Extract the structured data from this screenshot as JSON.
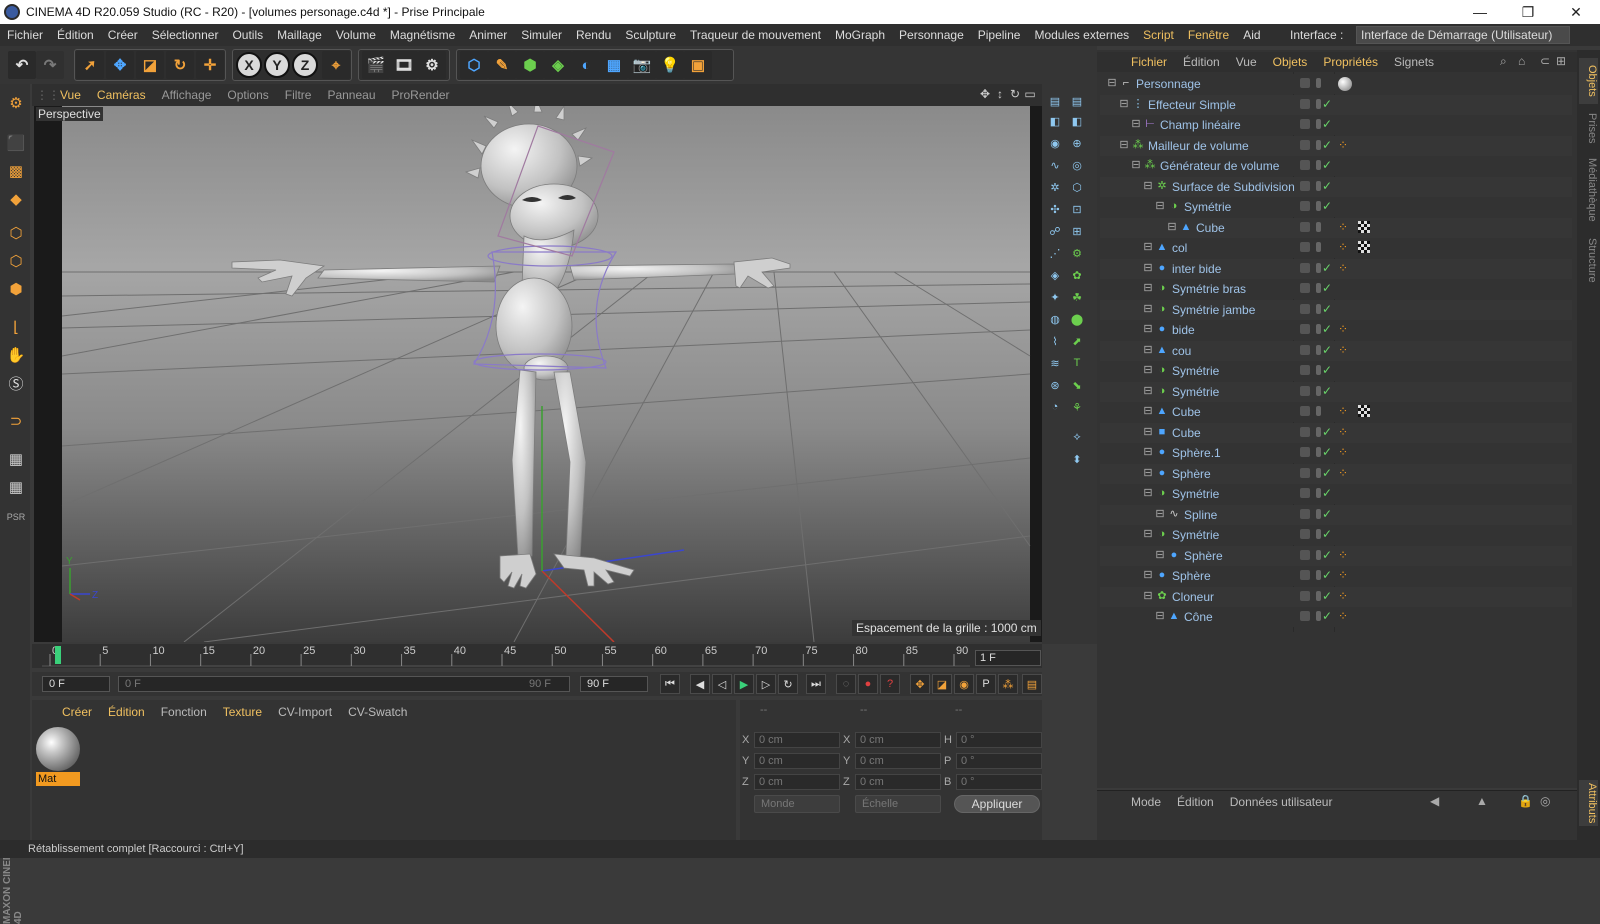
{
  "window": {
    "title": "CINEMA 4D R20.059 Studio (RC - R20) - [volumes personage.c4d *] - Prise Principale",
    "controls": [
      "—",
      "❐",
      "✕"
    ]
  },
  "menubar": {
    "items": [
      "Fichier",
      "Édition",
      "Créer",
      "Sélectionner",
      "Outils",
      "Maillage",
      "Volume",
      "Magnétisme",
      "Animer",
      "Simuler",
      "Rendu",
      "Sculpture",
      "Traqueur de mouvement",
      "MoGraph",
      "Personnage",
      "Pipeline",
      "Modules externes",
      "Script",
      "Fenêtre",
      "Aid"
    ],
    "interface_label": "Interface :",
    "interface_value": "Interface de Démarrage (Utilisateur)"
  },
  "viewport": {
    "menu": [
      "Vue",
      "Caméras",
      "Affichage",
      "Options",
      "Filtre",
      "Panneau",
      "ProRender"
    ],
    "camera_label": "Perspective",
    "grid_label": "Espacement de la grille : 1000 cm",
    "axis_labels": {
      "y": "Y",
      "z": "Z"
    }
  },
  "timeline": {
    "ticks": [
      "0",
      "5",
      "10",
      "15",
      "20",
      "25",
      "30",
      "35",
      "40",
      "45",
      "50",
      "55",
      "60",
      "65",
      "70",
      "75",
      "80",
      "85",
      "90"
    ],
    "current_frame": "1 F",
    "start_field": "0 F",
    "slider_start": "0 F",
    "slider_end": "90 F",
    "end_field": "90 F"
  },
  "material_manager": {
    "menu": [
      "Créer",
      "Édition",
      "Fonction",
      "Texture",
      "CV-Import",
      "CV-Swatch"
    ],
    "materials": [
      {
        "name": "Mat"
      }
    ]
  },
  "coordinates": {
    "headers": [
      "--",
      "--",
      "--"
    ],
    "rows": [
      {
        "a": "X",
        "av": "0 cm",
        "b": "X",
        "bv": "0 cm",
        "c": "H",
        "cv": "0 °"
      },
      {
        "a": "Y",
        "av": "0 cm",
        "b": "Y",
        "bv": "0 cm",
        "c": "P",
        "cv": "0 °"
      },
      {
        "a": "Z",
        "av": "0 cm",
        "b": "Z",
        "bv": "0 cm",
        "c": "B",
        "cv": "0 °"
      }
    ],
    "mode_select": "Monde",
    "scale_select": "Échelle",
    "apply_label": "Appliquer"
  },
  "object_manager": {
    "menu": [
      "Fichier",
      "Édition",
      "Vue",
      "Objets",
      "Propriétés",
      "Signets"
    ],
    "objects": [
      {
        "name": "Personnage",
        "depth": 0,
        "icon": "null-icon",
        "tags": [
          "sphere-mat"
        ],
        "check": false
      },
      {
        "name": "Effecteur Simple",
        "depth": 1,
        "icon": "effector-icon",
        "tags": [],
        "check": true
      },
      {
        "name": "Champ linéaire",
        "depth": 2,
        "icon": "field-icon",
        "tags": [],
        "check": true
      },
      {
        "name": "Mailleur de volume",
        "depth": 1,
        "icon": "volume-mesher-icon",
        "tags": [
          "phong"
        ],
        "check": true
      },
      {
        "name": "Générateur de volume",
        "depth": 2,
        "icon": "volume-builder-icon",
        "tags": [],
        "check": true
      },
      {
        "name": "Surface de Subdivision",
        "depth": 3,
        "icon": "subdivision-icon",
        "tags": [],
        "check": true
      },
      {
        "name": "Symétrie",
        "depth": 4,
        "icon": "symmetry-icon",
        "tags": [],
        "check": true
      },
      {
        "name": "Cube",
        "depth": 5,
        "icon": "polygon-icon",
        "tags": [
          "phong",
          "checker"
        ],
        "check": false
      },
      {
        "name": "col",
        "depth": 3,
        "icon": "polygon-icon",
        "tags": [
          "phong",
          "checker"
        ],
        "check": false
      },
      {
        "name": "inter bide",
        "depth": 3,
        "icon": "sphere-icon",
        "tags": [
          "phong"
        ],
        "check": true
      },
      {
        "name": "Symétrie bras",
        "depth": 3,
        "icon": "symmetry-icon",
        "tags": [],
        "check": true
      },
      {
        "name": "Symétrie jambe",
        "depth": 3,
        "icon": "symmetry-icon",
        "tags": [],
        "check": true
      },
      {
        "name": "bide",
        "depth": 3,
        "icon": "sphere-icon",
        "tags": [
          "phong"
        ],
        "check": true
      },
      {
        "name": "cou",
        "depth": 3,
        "icon": "cone-icon",
        "tags": [
          "phong"
        ],
        "check": true
      },
      {
        "name": "Symétrie",
        "depth": 3,
        "icon": "symmetry-icon",
        "tags": [],
        "check": true
      },
      {
        "name": "Symétrie",
        "depth": 3,
        "icon": "symmetry-icon",
        "tags": [],
        "check": true
      },
      {
        "name": "Cube",
        "depth": 3,
        "icon": "polygon-icon",
        "tags": [
          "phong",
          "checker"
        ],
        "check": false
      },
      {
        "name": "Cube",
        "depth": 3,
        "icon": "cube-icon",
        "tags": [
          "phong"
        ],
        "check": true
      },
      {
        "name": "Sphère.1",
        "depth": 3,
        "icon": "sphere-icon",
        "tags": [
          "phong"
        ],
        "check": true
      },
      {
        "name": "Sphère",
        "depth": 3,
        "icon": "sphere-icon",
        "tags": [
          "phong"
        ],
        "check": true
      },
      {
        "name": "Symétrie",
        "depth": 3,
        "icon": "symmetry-icon",
        "tags": [],
        "check": true
      },
      {
        "name": "Spline",
        "depth": 4,
        "icon": "spline-icon",
        "tags": [],
        "check": true
      },
      {
        "name": "Symétrie",
        "depth": 3,
        "icon": "symmetry-icon",
        "tags": [],
        "check": true
      },
      {
        "name": "Sphère",
        "depth": 4,
        "icon": "sphere-icon",
        "tags": [
          "phong"
        ],
        "check": true
      },
      {
        "name": "Sphère",
        "depth": 3,
        "icon": "sphere-icon",
        "tags": [
          "phong"
        ],
        "check": true
      },
      {
        "name": "Cloneur",
        "depth": 3,
        "icon": "cloner-icon",
        "tags": [
          "phong"
        ],
        "check": true
      },
      {
        "name": "Cône",
        "depth": 4,
        "icon": "cone-icon",
        "tags": [
          "phong"
        ],
        "check": true
      }
    ]
  },
  "attribute_manager": {
    "menu": [
      "Mode",
      "Édition",
      "Données utilisateur"
    ]
  },
  "side_tabs": [
    "Objets",
    "Prises",
    "Médiathèque",
    "Structure",
    "Attributs"
  ],
  "statusbar": {
    "text": "Rétablissement complet [Raccourci : Ctrl+Y]"
  },
  "brand": {
    "logo_text": "MAXON CINEMA 4D"
  },
  "colors": {
    "accent": "#f0c060",
    "object_name": "#9fc3e8",
    "check": "#69d46a",
    "tag": "#f29a20"
  }
}
